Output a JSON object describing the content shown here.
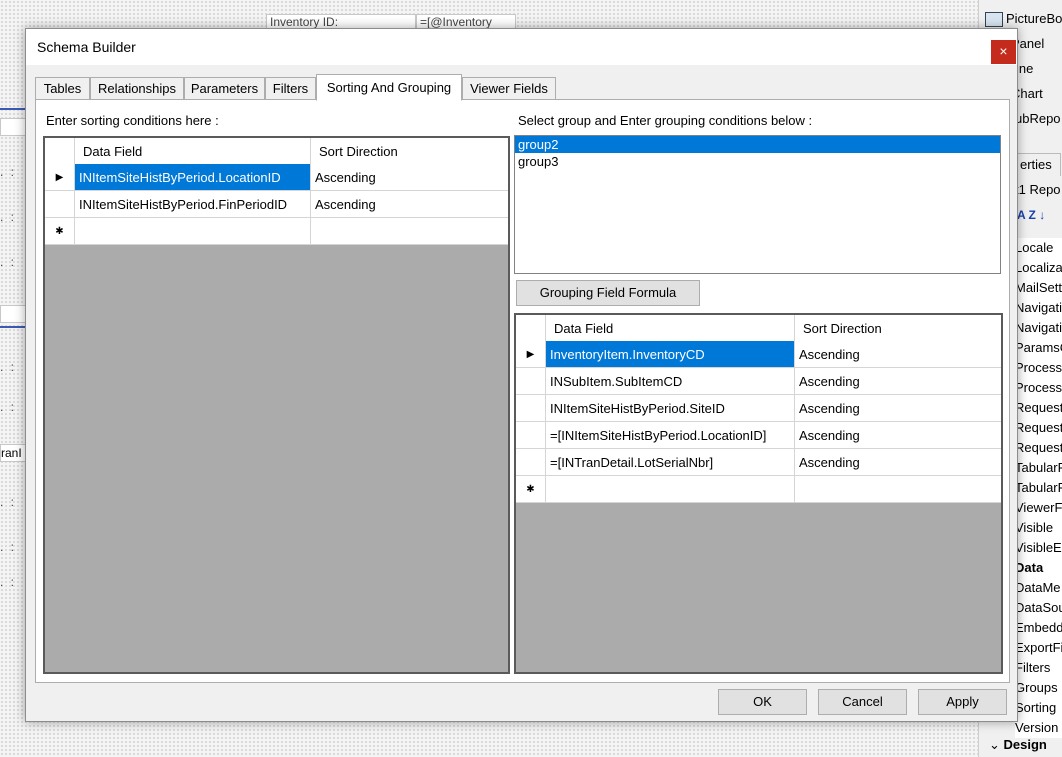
{
  "background": {
    "field_inventory_label": "Inventory ID:",
    "field_inventory_value": "=[@Inventory",
    "left_fragment": "ranI",
    "dots": ". :"
  },
  "right_panel": {
    "toolbox_items": [
      "PictureBo",
      "Panel",
      "ine",
      "Chart",
      "ubRepo"
    ],
    "properties_tab": "erties",
    "object_name": "t1 Repo",
    "sort_icon_label": "A Z ↓",
    "properties": [
      {
        "label": "Locale",
        "category": false
      },
      {
        "label": "Localiza",
        "category": false
      },
      {
        "label": "MailSett",
        "category": false
      },
      {
        "label": "Navigati",
        "category": false
      },
      {
        "label": "Navigati",
        "category": false
      },
      {
        "label": "ParamsC",
        "category": false
      },
      {
        "label": "Process",
        "category": false
      },
      {
        "label": "Process",
        "category": false
      },
      {
        "label": "Request",
        "category": false
      },
      {
        "label": "Request",
        "category": false
      },
      {
        "label": "Request",
        "category": false
      },
      {
        "label": "TabularR",
        "category": false
      },
      {
        "label": "TabularR",
        "category": false
      },
      {
        "label": "ViewerF",
        "category": false
      },
      {
        "label": "Visible",
        "category": false
      },
      {
        "label": "VisibleEx",
        "category": false
      },
      {
        "label": "Data",
        "category": true
      },
      {
        "label": "DataMe",
        "category": false
      },
      {
        "label": "DataSou",
        "category": false
      },
      {
        "label": "Embedd",
        "category": false
      },
      {
        "label": "ExportFi",
        "category": false
      },
      {
        "label": "Filters",
        "category": false
      },
      {
        "label": "Groups",
        "category": false
      },
      {
        "label": "Sorting",
        "category": false
      },
      {
        "label": "Version",
        "category": false
      }
    ],
    "design_category": "Design"
  },
  "dialog": {
    "title": "Schema Builder",
    "close_glyph": "×",
    "tabs": [
      "Tables",
      "Relationships",
      "Parameters",
      "Filters",
      "Sorting And Grouping",
      "Viewer Fields"
    ],
    "active_tab": "Sorting And Grouping",
    "sorting": {
      "label": "Enter sorting conditions here :",
      "columns": [
        "Data Field",
        "Sort Direction"
      ],
      "rows": [
        {
          "field": "INItemSiteHistByPeriod.LocationID",
          "direction": "Ascending"
        },
        {
          "field": "INItemSiteHistByPeriod.FinPeriodID",
          "direction": "Ascending"
        }
      ]
    },
    "grouping": {
      "label": "Select group and Enter grouping conditions below :",
      "groups": [
        "group2",
        "group3"
      ],
      "selected_group": "group2",
      "formula_button": "Grouping Field Formula",
      "columns": [
        "Data Field",
        "Sort Direction"
      ],
      "rows": [
        {
          "field": "InventoryItem.InventoryCD",
          "direction": "Ascending"
        },
        {
          "field": "INSubItem.SubItemCD",
          "direction": "Ascending"
        },
        {
          "field": "INItemSiteHistByPeriod.SiteID",
          "direction": "Ascending"
        },
        {
          "field": "=[INItemSiteHistByPeriod.LocationID]",
          "direction": "Ascending"
        },
        {
          "field": "=[INTranDetail.LotSerialNbr]",
          "direction": "Ascending"
        }
      ]
    },
    "buttons": {
      "ok": "OK",
      "cancel": "Cancel",
      "apply": "Apply"
    }
  },
  "glyphs": {
    "current_row": "▶",
    "new_row": "✱"
  },
  "colors": {
    "selection": "#0078d7",
    "close": "#c42b1c",
    "grid_empty": "#ababab"
  }
}
